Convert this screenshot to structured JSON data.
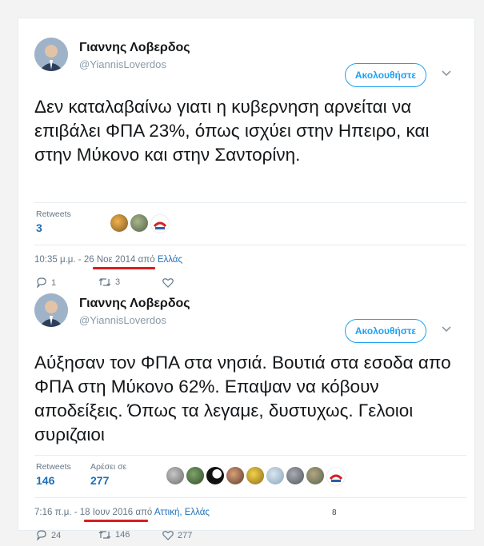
{
  "tweets": [
    {
      "author_name": "Γιαννης Λοβερδος",
      "author_handle": "@YiannisLoverdos",
      "follow_label": "Ακολουθήστε",
      "text": "Δεν καταλαβαίνω γιατι η κυβερνηση αρνείται να επιβάλει ΦΠΑ 23%, όπως ισχύει στην Ηπειρο,  και στην Μύκονο και στην Σαντορίνη.",
      "retweets_label": "Retweets",
      "retweets_count": "3",
      "time": "10:35 μ.μ. - ",
      "date": "26 Νοε 2014",
      "from": " από ",
      "place": "Ελλάς",
      "reply_count": "1",
      "retweet_count": "3",
      "like_count": ""
    },
    {
      "author_name": "Γιαννης Λοβερδος",
      "author_handle": "@YiannisLoverdos",
      "follow_label": "Ακολουθήστε",
      "text": "Αύξησαν τον ΦΠΑ στα νησιά. Βουτιά στα εσοδα απο ΦΠΑ στη Μύκονο 62%. Επαψαν να κόβουν αποδείξεις. Όπως τα λεγαμε, δυστυχως. Γελοιοι συριζαιοι",
      "retweets_label": "Retweets",
      "retweets_count": "146",
      "likes_label": "Αρέσει σε",
      "likes_count": "277",
      "time": "7:16 π.μ. - ",
      "date": "18 Ιουν 2016",
      "from": " από ",
      "place": "Αττική, Ελλάς",
      "reply_count": "24",
      "retweet_count": "146",
      "like_count": "277"
    }
  ],
  "corner_mark": "8",
  "colors": {
    "accent": "#1da1f2",
    "link": "#1d6fb8",
    "highlight": "#d81e1e"
  },
  "icons": {
    "reply": "reply-icon",
    "retweet": "retweet-icon",
    "like": "heart-icon",
    "caret": "chevron-down-icon"
  }
}
